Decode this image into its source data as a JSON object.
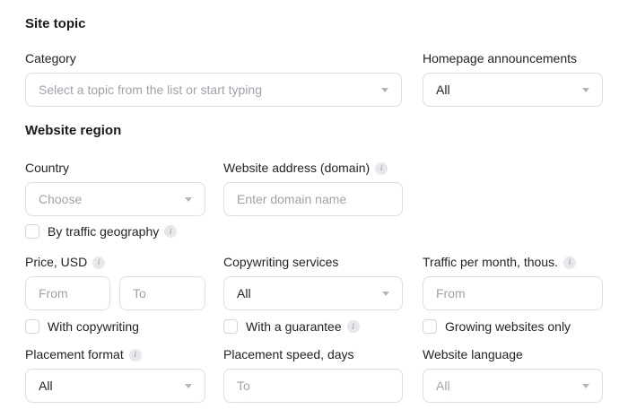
{
  "site_topic": {
    "heading": "Site topic",
    "category": {
      "label": "Category",
      "placeholder": "Select a topic from the list or start typing"
    },
    "homepage_announcements": {
      "label": "Homepage announcements",
      "value": "All"
    }
  },
  "website_region": {
    "heading": "Website region",
    "country": {
      "label": "Country",
      "placeholder": "Choose"
    },
    "website_address": {
      "label": "Website address (domain)",
      "placeholder": "Enter domain name"
    },
    "by_traffic_geography": {
      "label": "By traffic geography",
      "checked": false
    }
  },
  "filters": {
    "price": {
      "label": "Price, USD",
      "from_placeholder": "From",
      "to_placeholder": "To"
    },
    "copywriting_services": {
      "label": "Copywriting services",
      "value": "All"
    },
    "traffic_per_month": {
      "label": "Traffic per month, thous.",
      "from_placeholder": "From"
    },
    "with_copywriting": {
      "label": "With copywriting",
      "checked": false
    },
    "with_a_guarantee": {
      "label": "With a guarantee",
      "checked": false
    },
    "growing_websites_only": {
      "label": "Growing websites only",
      "checked": false
    },
    "placement_format": {
      "label": "Placement format",
      "value": "All"
    },
    "placement_speed": {
      "label": "Placement speed, days",
      "placeholder": "To"
    },
    "website_language": {
      "label": "Website language",
      "value": "All"
    }
  },
  "icons": {
    "info_glyph": "i"
  },
  "colors": {
    "text": "#1d2025",
    "placeholder": "#9ea3ab",
    "border": "#dcdee2",
    "info_icon_bg": "#e7e8eb",
    "caret": "#b2b6bc"
  }
}
